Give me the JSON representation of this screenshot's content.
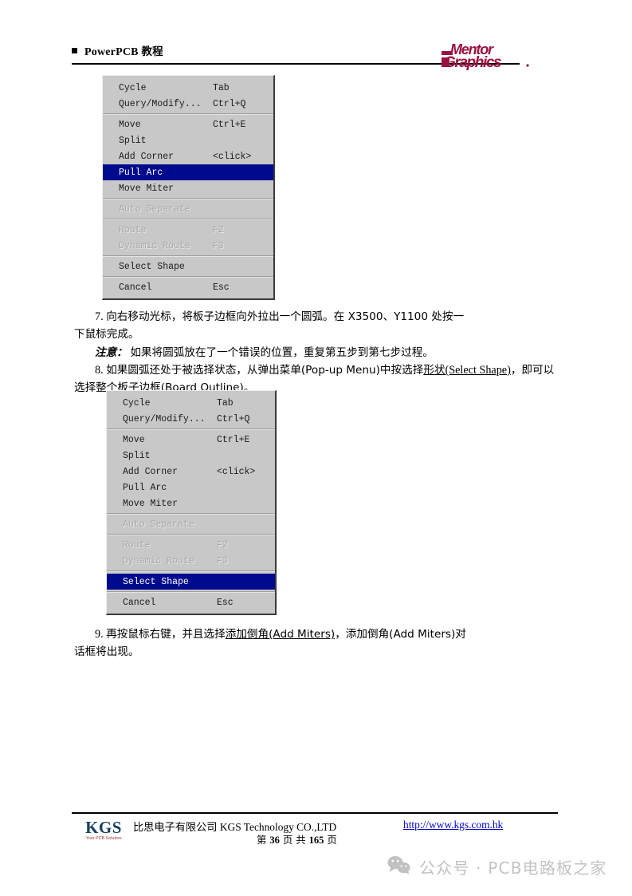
{
  "header": {
    "bullet_icon": "square-bullet-icon",
    "title_en": "PowerPCB",
    "title_cn": "教程",
    "logo_alt": "Mentor Graphics",
    "logo_line1": "Mentor",
    "logo_line2": "Graphics",
    "logo_color": "#9c1040"
  },
  "menus": [
    {
      "id": "menu-one",
      "groups": [
        [
          {
            "label": "Cycle",
            "accel": "Tab",
            "state": "normal"
          },
          {
            "label": "Query/Modify...",
            "accel": "Ctrl+Q",
            "state": "normal"
          }
        ],
        [
          {
            "label": "Move",
            "accel": "Ctrl+E",
            "state": "normal"
          },
          {
            "label": "Split",
            "accel": "",
            "state": "normal"
          },
          {
            "label": "Add Corner",
            "accel": "<click>",
            "state": "normal"
          },
          {
            "label": "Pull Arc",
            "accel": "",
            "state": "selected"
          },
          {
            "label": "Move Miter",
            "accel": "",
            "state": "normal"
          }
        ],
        [
          {
            "label": "Auto Separate",
            "accel": "",
            "state": "disabled"
          }
        ],
        [
          {
            "label": "Route",
            "accel": "F2",
            "state": "disabled"
          },
          {
            "label": "Dynamic Route",
            "accel": "F3",
            "state": "disabled"
          }
        ],
        [
          {
            "label": "Select Shape",
            "accel": "",
            "state": "normal"
          }
        ],
        [
          {
            "label": "Cancel",
            "accel": "Esc",
            "state": "normal"
          }
        ]
      ]
    },
    {
      "id": "menu-two",
      "groups": [
        [
          {
            "label": "Cycle",
            "accel": "Tab",
            "state": "normal"
          },
          {
            "label": "Query/Modify...",
            "accel": "Ctrl+Q",
            "state": "normal"
          }
        ],
        [
          {
            "label": "Move",
            "accel": "Ctrl+E",
            "state": "normal"
          },
          {
            "label": "Split",
            "accel": "",
            "state": "normal"
          },
          {
            "label": "Add Corner",
            "accel": "<click>",
            "state": "normal"
          },
          {
            "label": "Pull Arc",
            "accel": "",
            "state": "normal"
          },
          {
            "label": "Move Miter",
            "accel": "",
            "state": "normal"
          }
        ],
        [
          {
            "label": "Auto Separate",
            "accel": "",
            "state": "disabled"
          }
        ],
        [
          {
            "label": "Route",
            "accel": "F2",
            "state": "disabled"
          },
          {
            "label": "Dynamic Route",
            "accel": "F3",
            "state": "disabled"
          }
        ],
        [
          {
            "label": "Select Shape",
            "accel": "",
            "state": "selected"
          }
        ],
        [
          {
            "label": "Cancel",
            "accel": "Esc",
            "state": "normal"
          }
        ]
      ]
    }
  ],
  "body": {
    "para7_num": "7.",
    "para7_line1": "向右移动光标，将板子边框向外拉出一个圆弧。在 X3500、Y1100 处按一",
    "para7_line2": "下鼠标完成。",
    "note_label": "注意：",
    "note_text": "如果将圆弧放在了一个错误的位置，重复第五步到第七步过程。",
    "para8_num": "8.",
    "para8_a": "如果圆弧还处于被选择状态，从弹出菜单(Pop-up  Menu)中按选择",
    "para8_link1": "形状",
    "para8_link2": "(Select Shape)",
    "para8_b": "，即可以选择整个板子边框(Board Outline)。",
    "para9_num": "9.",
    "para9_a": "再按鼠标右键，并且选择",
    "para9_link": "添加倒角(Add Miters)",
    "para9_b": "，添加倒角(Add Miters)对",
    "para9_line2": "话框将出现。"
  },
  "footer": {
    "logo_main": "KGS",
    "logo_sub": "-Your PCB Solution-",
    "company_cn": "比思电子有限公司",
    "company_en": "KGS Technology CO.,LTD",
    "page_prefix": "第",
    "page_current": "36",
    "page_mid": "页 共",
    "page_total": "165",
    "page_suffix": "页",
    "url": "http://www.kgs.com.hk"
  },
  "watermark": {
    "icon": "wechat-icon",
    "text": "公众号 · PCB电路板之家",
    "color": "#c2c2c2"
  }
}
